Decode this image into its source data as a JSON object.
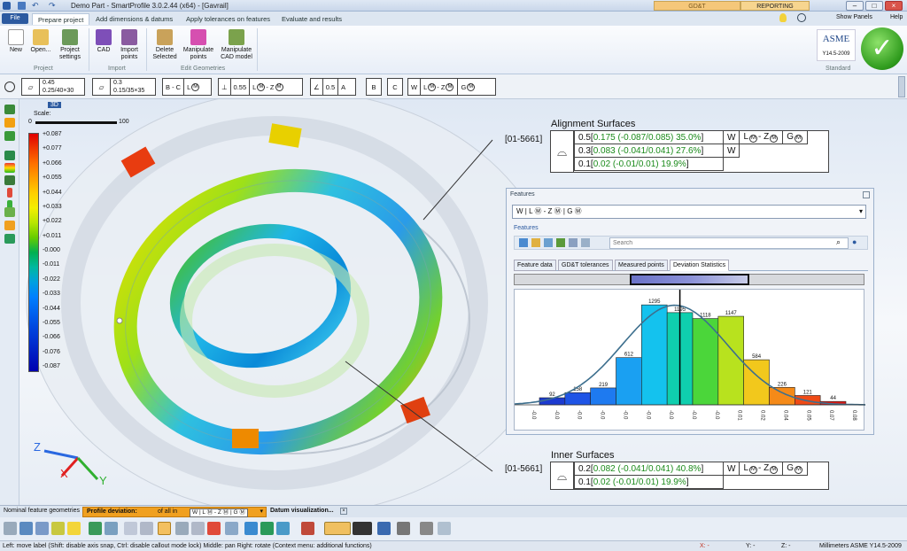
{
  "window": {
    "title": "Demo Part - SmartProfile 3.0.2.44 (x64) - [Gavrail]",
    "mode_tabs": [
      "GD&T",
      "REPORTING"
    ],
    "show_panels": "Show Panels",
    "help": "Help"
  },
  "tabs": {
    "file": "File",
    "items": [
      "Prepare project",
      "Add dimensions & datums",
      "Apply tolerances on features",
      "Evaluate and results"
    ]
  },
  "ribbon": {
    "buttons": [
      "New",
      "Open...",
      "Project settings",
      "CAD",
      "Import points",
      "Delete Selected",
      "Manipulate points",
      "Manipulate CAD model"
    ],
    "groups": [
      "Project",
      "Import",
      "Edit Geometries",
      "Standard"
    ],
    "asme": {
      "logo": "ASME",
      "std": "Y14.5-2009"
    }
  },
  "fcf_bar": {
    "f1_top": "0.45",
    "f1_bot": "0.25/40×30",
    "f2_top": "0.3",
    "f2_bot": "0.15/35×35",
    "f3": [
      "B - C",
      "L",
      "M"
    ],
    "f4": [
      "0.55",
      "L",
      "M",
      "- Z",
      "M"
    ],
    "f5": [
      "0.5",
      "A"
    ],
    "f6": "B",
    "f7": "C",
    "f8": [
      "W",
      "L",
      "M",
      "- Z",
      "M",
      "G",
      "M"
    ]
  },
  "legend": {
    "title": "3D",
    "scale_label": "Scale:",
    "scale_min": "0",
    "scale_max": "100",
    "values": [
      "+0.087",
      "+0.077",
      "+0.066",
      "+0.055",
      "+0.044",
      "+0.033",
      "+0.022",
      "+0.011",
      "-0.000",
      "-0.011",
      "-0.022",
      "-0.033",
      "-0.044",
      "-0.055",
      "-0.066",
      "-0.076",
      "-0.087"
    ],
    "colors": [
      "#e00000",
      "#f03a00",
      "#ff7000",
      "#ff9f00",
      "#ffcf00",
      "#f4ee00",
      "#b8e600",
      "#66cc00",
      "#00b050",
      "#00b8a0",
      "#00a0e0",
      "#0080ff",
      "#0064f0",
      "#0048e0",
      "#0030d0",
      "#0018c0",
      "#0000b0"
    ]
  },
  "axes": {
    "z": "Z",
    "x": "X",
    "y": "Y"
  },
  "alignment": {
    "title": "Alignment Surfaces",
    "id": "[01-5661]",
    "rows": [
      {
        "prefix": "0.5[",
        "val": "0.175 (-0.087/0.085) 35.0%",
        "suffix": "]"
      },
      {
        "prefix": "0.3[",
        "val": "0.083 (-0.041/0.041) 27.6%",
        "suffix": "]"
      },
      {
        "prefix": "0.1[",
        "val": "0.02 (-0.01/0.01) 19.9%",
        "suffix": "]"
      }
    ],
    "datum_w": "W",
    "datum_lz": "L",
    "datum_lz2": "- Z",
    "datum_g": "G"
  },
  "inner": {
    "title": "Inner Surfaces",
    "id": "[01-5661]",
    "rows": [
      {
        "prefix": "0.2[",
        "val": "0.082 (-0.041/0.041) 40.8%",
        "suffix": "]"
      },
      {
        "prefix": "0.1[",
        "val": "0.02 (-0.01/0.01) 19.9%",
        "suffix": "]"
      }
    ]
  },
  "features": {
    "title": "Features",
    "select": "W | L Ⓜ - Z Ⓜ | G Ⓜ",
    "section": "Features",
    "search_placeholder": "Search",
    "tabs": [
      "Feature data",
      "GD&T tolerances",
      "Measured points",
      "Deviation Statistics"
    ]
  },
  "chart_data": {
    "type": "bar",
    "title": "",
    "categories": [
      "-0.0",
      "-0.0",
      "-0.0",
      "-0.0",
      "-0.0",
      "-0.0",
      "-0.0",
      "-0.0",
      "-0.0",
      "0.01",
      "0.02",
      "0.04",
      "0.05",
      "0.07",
      "0.08"
    ],
    "values": [
      92,
      158,
      219,
      612,
      1295,
      1195,
      1118,
      1147,
      584,
      226,
      121,
      44
    ],
    "bar_labels": [
      "92",
      "158",
      "219",
      "612",
      "1295",
      "1195",
      "1118",
      "1147",
      "584",
      "226",
      "121",
      "44"
    ],
    "bar_colors": [
      "#1c3ad0",
      "#1e54e6",
      "#1e7af0",
      "#1aa0f2",
      "#14c2ee",
      "#0fcfae",
      "#4bd63a",
      "#b8e21e",
      "#f2c81c",
      "#f58a18",
      "#ef4a16",
      "#e01a14"
    ],
    "xlabel": "",
    "ylabel": "",
    "ylim": [
      0,
      1400
    ]
  },
  "bottom": {
    "tabs": [
      "Nominal feature geometries",
      "Profile deviation:",
      "of all in",
      "W | L Ⓜ - Z Ⓜ | G Ⓜ",
      "Datum visualization..."
    ]
  },
  "status": {
    "left": "Left: move label (Shift: disable axis snap, Ctrl: disable callout mode lock)  Middle: pan  Right: rotate (Context menu: additional functions)",
    "x": "X: -",
    "y": "Y: -",
    "z": "Z: -",
    "units": "Millimeters  ASME Y14.5-2009"
  }
}
